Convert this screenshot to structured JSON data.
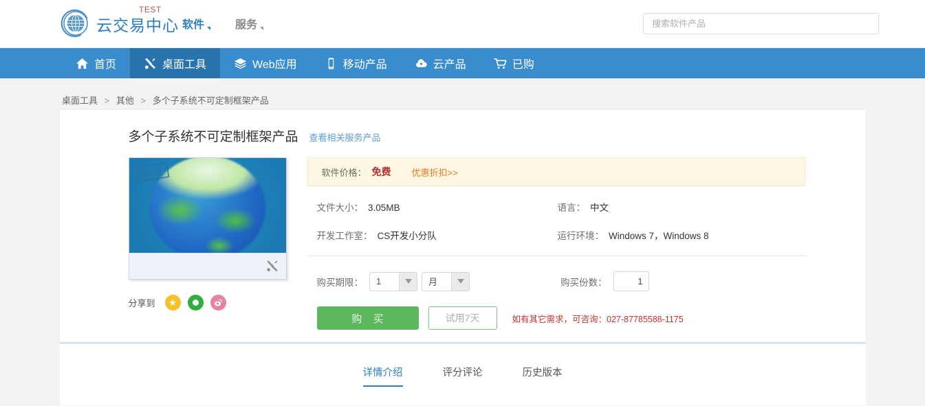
{
  "header": {
    "logo_icon": "globe-icon",
    "logo_text": "云交易中心",
    "test_badge": "TEST",
    "menu": [
      {
        "label": "软件",
        "active": true
      },
      {
        "label": "服务",
        "active": false
      }
    ],
    "search": {
      "placeholder": "搜索软件产品",
      "value": ""
    }
  },
  "nav": {
    "items": [
      {
        "label": "首页",
        "icon": "home-icon",
        "active": false
      },
      {
        "label": "桌面工具",
        "icon": "tools-icon",
        "active": true
      },
      {
        "label": "Web应用",
        "icon": "layers-icon",
        "active": false
      },
      {
        "label": "移动产品",
        "icon": "mobile-icon",
        "active": false
      },
      {
        "label": "云产品",
        "icon": "cloud-icon",
        "active": false
      },
      {
        "label": "已购",
        "icon": "cart-icon",
        "active": false
      }
    ]
  },
  "breadcrumb": {
    "items": [
      "桌面工具",
      "其他",
      "多个子系统不可定制框架产品"
    ],
    "separator": ">"
  },
  "product": {
    "title": "多个子系统不可定制框架产品",
    "related_link": "查看相关服务产品",
    "image": {
      "beta_stamp": "测试版",
      "tool_icon": "tools-icon"
    },
    "share": {
      "label": "分享到",
      "buttons": [
        {
          "name": "qzone",
          "glyph": "★",
          "color": "#f5c22b"
        },
        {
          "name": "wechat",
          "glyph": "",
          "color": "#2fad3e"
        },
        {
          "name": "weibo",
          "glyph": "◉",
          "color": "#e5849e"
        }
      ]
    },
    "price": {
      "label": "软件价格：",
      "value": "免费",
      "discount_link": "优惠折扣>>"
    },
    "meta": [
      {
        "key": "文件大小：",
        "value": "3.05MB"
      },
      {
        "key": "语言：",
        "value": "中文"
      },
      {
        "key": "开发工作室：",
        "value": "CS开发小分队"
      },
      {
        "key": "运行环境：",
        "value": "Windows 7，Windows 8"
      }
    ],
    "purchase": {
      "term_label": "购买期限：",
      "term_number": "1",
      "term_unit": "月",
      "qty_label": "购买份数：",
      "qty_value": "1"
    },
    "actions": {
      "buy_label": "购 买",
      "trial_label": "试用7天",
      "contact_note": "如有其它需求，可咨询：027-87785588-1175"
    }
  },
  "tabs": [
    {
      "label": "详情介绍",
      "active": true
    },
    {
      "label": "评分评论",
      "active": false
    },
    {
      "label": "历史版本",
      "active": false
    }
  ],
  "colors": {
    "nav_bg": "#3a8dcc",
    "nav_active_bg": "#2873ae",
    "brand_blue": "#2a7ec4",
    "price_red": "#b03030",
    "discount_orange": "#e08020",
    "buy_green": "#5cb85c",
    "contact_red": "#c9302c",
    "page_bg": "#f3f3f3"
  }
}
